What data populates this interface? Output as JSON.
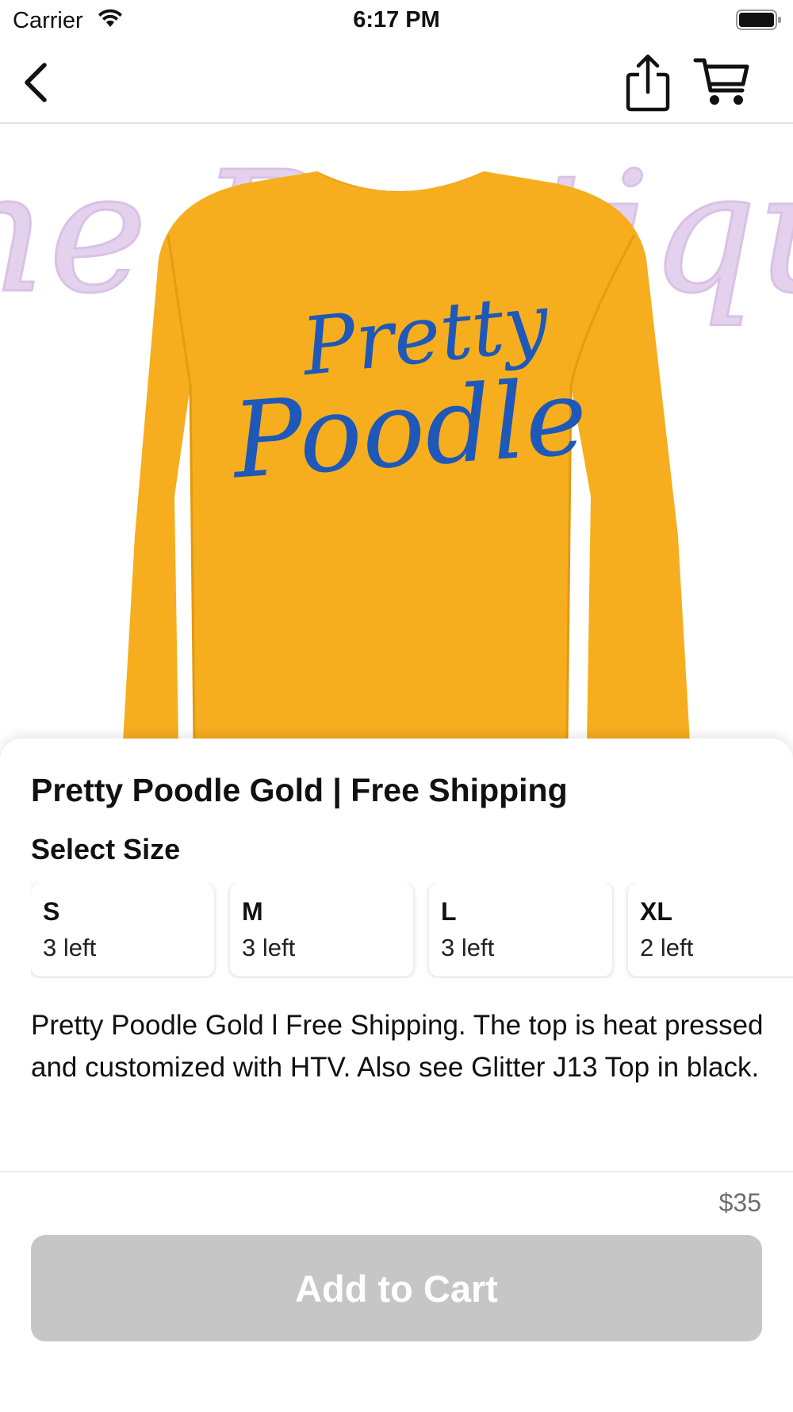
{
  "status_bar": {
    "carrier": "Carrier",
    "time": "6:17 PM",
    "icons": [
      "wifi-icon",
      "battery-icon"
    ]
  },
  "nav": {
    "icons": [
      "chevron-left-icon",
      "share-icon",
      "cart-icon"
    ]
  },
  "product_image": {
    "watermark_text": "The Boutique",
    "shirt_print_line1": "Pretty",
    "shirt_print_line2": "Poodle",
    "shirt_color": "#F6AE1E",
    "print_color": "#1E58B8",
    "watermark_color": "#E4D1EE"
  },
  "product": {
    "title": "Pretty Poodle Gold | Free Shipping",
    "select_size_label": "Select Size",
    "sizes": [
      {
        "label": "S",
        "stock": "3 left"
      },
      {
        "label": "M",
        "stock": "3 left"
      },
      {
        "label": "L",
        "stock": "3 left"
      },
      {
        "label": "XL",
        "stock": "2 left"
      }
    ],
    "description": "Pretty Poodle Gold l Free Shipping. The top is heat pressed and customized with HTV. Also see Glitter J13 Top in black."
  },
  "footer": {
    "price": "$35",
    "add_to_cart_label": "Add to Cart",
    "button_color": "#C6C6C6"
  }
}
